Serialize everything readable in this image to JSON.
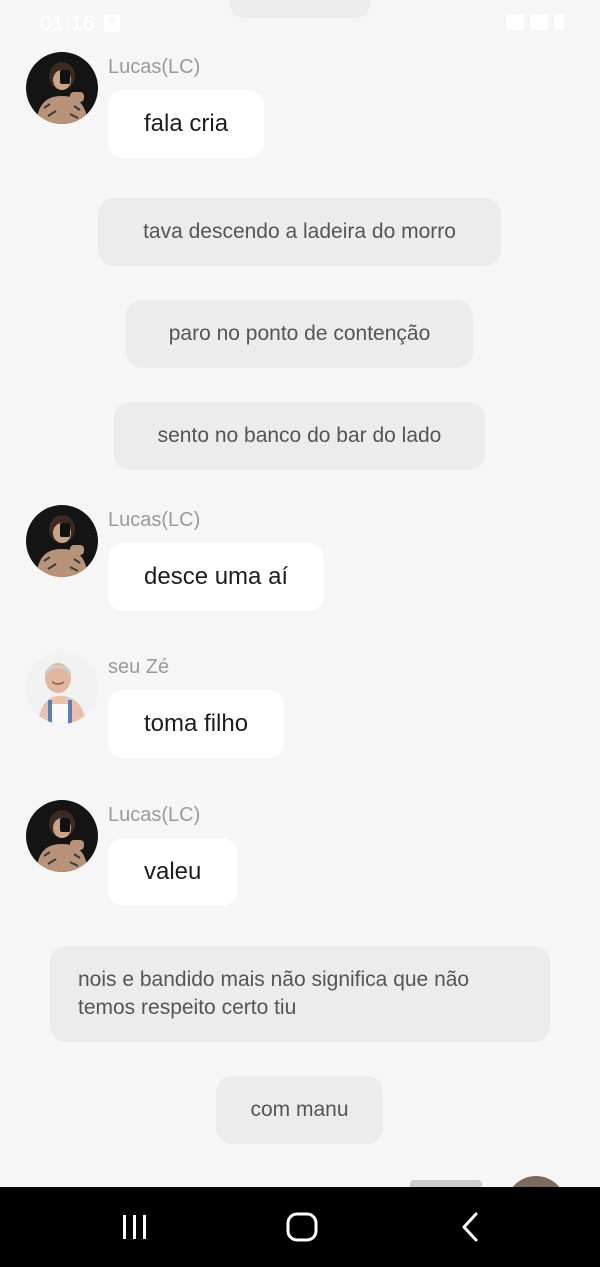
{
  "status": {
    "time": "01:16",
    "icons": [
      "download-icon",
      "wifi-icon",
      "signal-icon",
      "battery-icon"
    ]
  },
  "messages": [
    {
      "type": "incoming",
      "sender": "Lucas(LC)",
      "text": "fala cria",
      "avatar": "lucas-avatar"
    },
    {
      "type": "narration",
      "text": "tava descendo a ladeira do morro"
    },
    {
      "type": "narration",
      "text": "paro no ponto de contenção"
    },
    {
      "type": "narration",
      "text": "sento no banco do bar do lado"
    },
    {
      "type": "incoming",
      "sender": "Lucas(LC)",
      "text": "desce uma aí",
      "avatar": "lucas-avatar"
    },
    {
      "type": "incoming",
      "sender": "seu Zé",
      "text": "toma filho",
      "avatar": "seu-ze-avatar"
    },
    {
      "type": "incoming",
      "sender": "Lucas(LC)",
      "text": "valeu",
      "avatar": "lucas-avatar"
    },
    {
      "type": "narration",
      "text": "nois e bandido mais não significa que não temos respeito certo tiu"
    },
    {
      "type": "narration",
      "text": "com manu"
    }
  ],
  "navbar": {
    "icons": [
      "recent-apps-icon",
      "home-icon",
      "back-icon"
    ]
  },
  "colors": {
    "background": "#f6f6f6",
    "incoming_bubble": "#ffffff",
    "narration_bubble": "#ececec",
    "sender_text": "#9a9a9a",
    "navbar": "#000000"
  }
}
